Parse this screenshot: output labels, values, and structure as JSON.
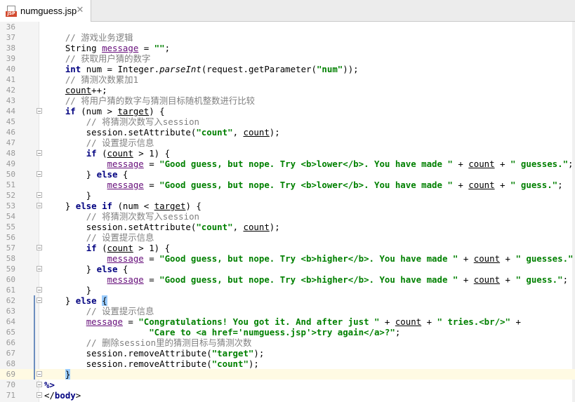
{
  "tab": {
    "file_icon": "jsp-file-icon",
    "file_icon_label": "JSP",
    "title": "numguess.jsp",
    "close": "✕"
  },
  "lines": [
    {
      "n": "36",
      "segs": [
        {
          "t": ""
        }
      ]
    },
    {
      "n": "37",
      "segs": [
        {
          "t": "    "
        },
        {
          "t": "// 游戏业务逻辑",
          "c": "cmt"
        }
      ]
    },
    {
      "n": "38",
      "segs": [
        {
          "t": "    String "
        },
        {
          "t": "message",
          "c": "fld ul"
        },
        {
          "t": " = "
        },
        {
          "t": "\"\"",
          "c": "str"
        },
        {
          "t": ";"
        }
      ]
    },
    {
      "n": "39",
      "segs": [
        {
          "t": "    "
        },
        {
          "t": "// 获取用户猜的数字",
          "c": "cmt"
        }
      ]
    },
    {
      "n": "40",
      "segs": [
        {
          "t": "    "
        },
        {
          "t": "int",
          "c": "kw"
        },
        {
          "t": " num = Integer."
        },
        {
          "t": "parseInt",
          "c": "ital"
        },
        {
          "t": "(request.getParameter("
        },
        {
          "t": "\"num\"",
          "c": "str"
        },
        {
          "t": "));"
        }
      ]
    },
    {
      "n": "41",
      "segs": [
        {
          "t": "    "
        },
        {
          "t": "// 猜测次数累加1",
          "c": "cmt"
        }
      ]
    },
    {
      "n": "42",
      "segs": [
        {
          "t": "    "
        },
        {
          "t": "count",
          "c": "ul"
        },
        {
          "t": "++;"
        }
      ]
    },
    {
      "n": "43",
      "segs": [
        {
          "t": "    "
        },
        {
          "t": "// 将用户猜的数字与猜测目标随机整数进行比较",
          "c": "cmt"
        }
      ]
    },
    {
      "n": "44",
      "fold": true,
      "segs": [
        {
          "t": "    "
        },
        {
          "t": "if",
          "c": "kw"
        },
        {
          "t": " (num > "
        },
        {
          "t": "target",
          "c": "ul"
        },
        {
          "t": ") {"
        }
      ]
    },
    {
      "n": "45",
      "segs": [
        {
          "t": "        "
        },
        {
          "t": "// 将猜测次数写入session",
          "c": "cmt"
        }
      ]
    },
    {
      "n": "46",
      "segs": [
        {
          "t": "        session.setAttribute("
        },
        {
          "t": "\"count\"",
          "c": "str"
        },
        {
          "t": ", "
        },
        {
          "t": "count",
          "c": "ul"
        },
        {
          "t": ");"
        }
      ]
    },
    {
      "n": "47",
      "segs": [
        {
          "t": "        "
        },
        {
          "t": "// 设置提示信息",
          "c": "cmt"
        }
      ]
    },
    {
      "n": "48",
      "fold": true,
      "segs": [
        {
          "t": "        "
        },
        {
          "t": "if",
          "c": "kw"
        },
        {
          "t": " ("
        },
        {
          "t": "count",
          "c": "ul"
        },
        {
          "t": " > 1) {"
        }
      ]
    },
    {
      "n": "49",
      "segs": [
        {
          "t": "            "
        },
        {
          "t": "message",
          "c": "fld ul"
        },
        {
          "t": " = "
        },
        {
          "t": "\"Good guess, but nope. Try <b>lower</b>. You have made \"",
          "c": "str"
        },
        {
          "t": " + "
        },
        {
          "t": "count",
          "c": "ul"
        },
        {
          "t": " + "
        },
        {
          "t": "\" guesses.\"",
          "c": "str"
        },
        {
          "t": ";"
        }
      ]
    },
    {
      "n": "50",
      "fold": true,
      "segs": [
        {
          "t": "        } "
        },
        {
          "t": "else",
          "c": "kw"
        },
        {
          "t": " {"
        }
      ]
    },
    {
      "n": "51",
      "segs": [
        {
          "t": "            "
        },
        {
          "t": "message",
          "c": "fld ul"
        },
        {
          "t": " = "
        },
        {
          "t": "\"Good guess, but nope. Try <b>lower</b>. You have made \"",
          "c": "str"
        },
        {
          "t": " + "
        },
        {
          "t": "count",
          "c": "ul"
        },
        {
          "t": " + "
        },
        {
          "t": "\" guess.\"",
          "c": "str"
        },
        {
          "t": ";"
        }
      ]
    },
    {
      "n": "52",
      "fold": true,
      "segs": [
        {
          "t": "        }"
        }
      ]
    },
    {
      "n": "53",
      "fold": true,
      "segs": [
        {
          "t": "    } "
        },
        {
          "t": "else if",
          "c": "kw"
        },
        {
          "t": " (num < "
        },
        {
          "t": "target",
          "c": "ul"
        },
        {
          "t": ") {"
        }
      ]
    },
    {
      "n": "54",
      "segs": [
        {
          "t": "        "
        },
        {
          "t": "// 将猜测次数写入session",
          "c": "cmt"
        }
      ]
    },
    {
      "n": "55",
      "segs": [
        {
          "t": "        session.setAttribute("
        },
        {
          "t": "\"count\"",
          "c": "str"
        },
        {
          "t": ", "
        },
        {
          "t": "count",
          "c": "ul"
        },
        {
          "t": ");"
        }
      ]
    },
    {
      "n": "56",
      "segs": [
        {
          "t": "        "
        },
        {
          "t": "// 设置提示信息",
          "c": "cmt"
        }
      ]
    },
    {
      "n": "57",
      "fold": true,
      "segs": [
        {
          "t": "        "
        },
        {
          "t": "if",
          "c": "kw"
        },
        {
          "t": " ("
        },
        {
          "t": "count",
          "c": "ul"
        },
        {
          "t": " > 1) {"
        }
      ]
    },
    {
      "n": "58",
      "segs": [
        {
          "t": "            "
        },
        {
          "t": "message",
          "c": "fld ul"
        },
        {
          "t": " = "
        },
        {
          "t": "\"Good guess, but nope. Try <b>higher</b>. You have made \"",
          "c": "str"
        },
        {
          "t": " + "
        },
        {
          "t": "count",
          "c": "ul"
        },
        {
          "t": " + "
        },
        {
          "t": "\" guesses.\"",
          "c": "str"
        },
        {
          "t": ";"
        }
      ]
    },
    {
      "n": "59",
      "fold": true,
      "segs": [
        {
          "t": "        } "
        },
        {
          "t": "else",
          "c": "kw"
        },
        {
          "t": " {"
        }
      ]
    },
    {
      "n": "60",
      "segs": [
        {
          "t": "            "
        },
        {
          "t": "message",
          "c": "fld ul"
        },
        {
          "t": " = "
        },
        {
          "t": "\"Good guess, but nope. Try <b>higher</b>. You have made \"",
          "c": "str"
        },
        {
          "t": " + "
        },
        {
          "t": "count",
          "c": "ul"
        },
        {
          "t": " + "
        },
        {
          "t": "\" guess.\"",
          "c": "str"
        },
        {
          "t": ";"
        }
      ]
    },
    {
      "n": "61",
      "fold": true,
      "segs": [
        {
          "t": "        }"
        }
      ]
    },
    {
      "n": "62",
      "fold": true,
      "segs": [
        {
          "t": "    } "
        },
        {
          "t": "else",
          "c": "kw"
        },
        {
          "t": " "
        },
        {
          "t": "{",
          "c": "brace"
        }
      ]
    },
    {
      "n": "63",
      "segs": [
        {
          "t": "        "
        },
        {
          "t": "// 设置提示信息",
          "c": "cmt"
        }
      ]
    },
    {
      "n": "64",
      "segs": [
        {
          "t": "        "
        },
        {
          "t": "message",
          "c": "fld ul"
        },
        {
          "t": " = "
        },
        {
          "t": "\"Congratulations! You got it. And after just \"",
          "c": "str"
        },
        {
          "t": " + "
        },
        {
          "t": "count",
          "c": "ul"
        },
        {
          "t": " + "
        },
        {
          "t": "\" tries.<br/>\"",
          "c": "str"
        },
        {
          "t": " +"
        }
      ]
    },
    {
      "n": "65",
      "segs": [
        {
          "t": "                    "
        },
        {
          "t": "\"Care to <a href='numguess.jsp'>try again</a>?\"",
          "c": "str"
        },
        {
          "t": ";"
        }
      ]
    },
    {
      "n": "66",
      "segs": [
        {
          "t": "        "
        },
        {
          "t": "// 删除session里的猜测目标与猜测次数",
          "c": "cmt"
        }
      ]
    },
    {
      "n": "67",
      "segs": [
        {
          "t": "        session.removeAttribute("
        },
        {
          "t": "\"target\"",
          "c": "str"
        },
        {
          "t": ");"
        }
      ]
    },
    {
      "n": "68",
      "segs": [
        {
          "t": "        session.removeAttribute("
        },
        {
          "t": "\"count\"",
          "c": "str"
        },
        {
          "t": ");"
        }
      ]
    },
    {
      "n": "69",
      "caret": true,
      "fold": true,
      "segs": [
        {
          "t": "    "
        },
        {
          "t": "}",
          "c": "brace"
        }
      ]
    },
    {
      "n": "70",
      "fold": true,
      "segs": [
        {
          "t": "%>",
          "c": "kw"
        }
      ]
    },
    {
      "n": "71",
      "fold": true,
      "segs": [
        {
          "t": "</"
        },
        {
          "t": "body",
          "c": "kw"
        },
        {
          "t": ">"
        }
      ]
    }
  ]
}
